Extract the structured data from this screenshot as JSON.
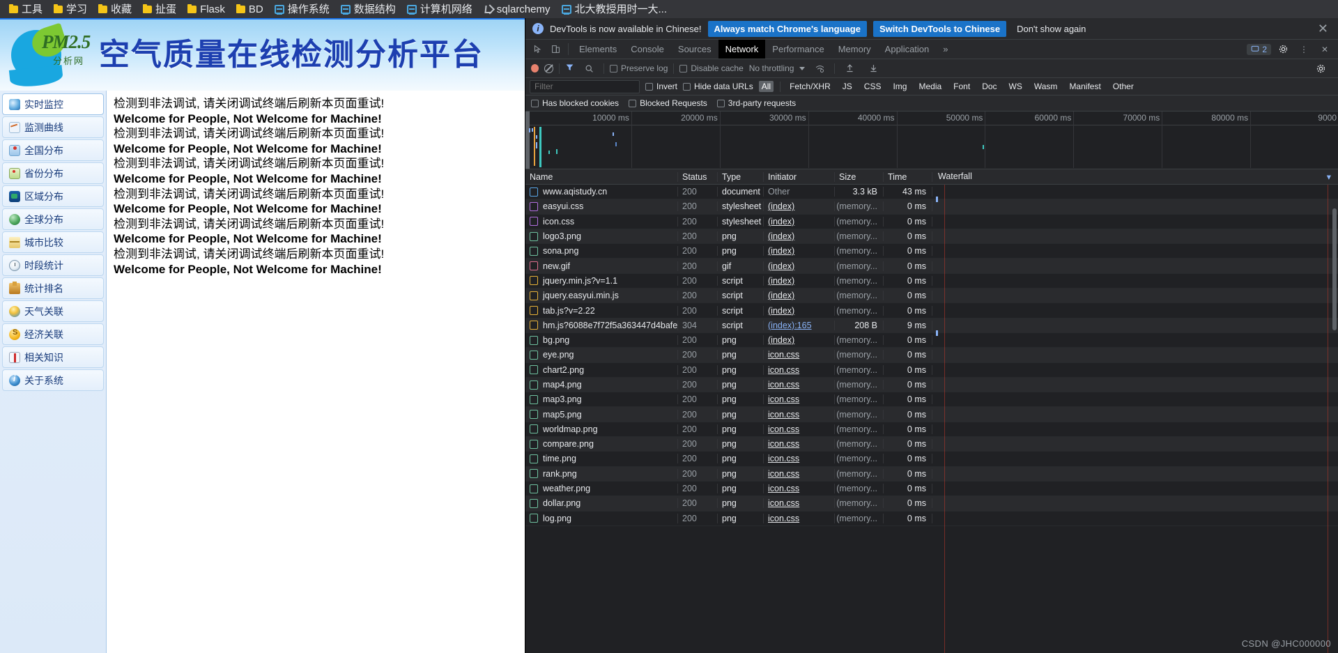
{
  "bookmarks": [
    {
      "label": "工具",
      "icon": "folder-icon"
    },
    {
      "label": "学习",
      "icon": "folder-icon"
    },
    {
      "label": "收藏",
      "icon": "folder-icon"
    },
    {
      "label": "扯蛋",
      "icon": "folder-icon"
    },
    {
      "label": "Flask",
      "icon": "folder-icon"
    },
    {
      "label": "BD",
      "icon": "folder-icon"
    },
    {
      "label": "操作系统",
      "icon": "page-icon"
    },
    {
      "label": "数据结构",
      "icon": "page-icon"
    },
    {
      "label": "计算机网络",
      "icon": "page-icon"
    },
    {
      "label": "sqlarchemy",
      "icon": "bookmark-alt-icon"
    },
    {
      "label": "北大教授用时一大...",
      "icon": "page-icon"
    }
  ],
  "site": {
    "logo_main": "PM2.5",
    "logo_sub": "分析网",
    "title": "空气质量在线检测分析平台"
  },
  "sidebar": {
    "items": [
      {
        "label": "实时监控",
        "icon": "realtime-monitor-icon",
        "active": true
      },
      {
        "label": "监测曲线",
        "icon": "chart-curve-icon",
        "active": false
      },
      {
        "label": "全国分布",
        "icon": "china-map-icon",
        "active": false
      },
      {
        "label": "省份分布",
        "icon": "province-map-icon",
        "active": false
      },
      {
        "label": "区域分布",
        "icon": "region-map-icon",
        "active": false
      },
      {
        "label": "全球分布",
        "icon": "globe-icon",
        "active": false
      },
      {
        "label": "城市比较",
        "icon": "compare-scale-icon",
        "active": false
      },
      {
        "label": "时段统计",
        "icon": "clock-icon",
        "active": false
      },
      {
        "label": "统计排名",
        "icon": "rank-podium-icon",
        "active": false
      },
      {
        "label": "天气关联",
        "icon": "weather-icon",
        "active": false
      },
      {
        "label": "经济关联",
        "icon": "coin-icon",
        "active": false
      },
      {
        "label": "相关知识",
        "icon": "book-icon",
        "active": false
      },
      {
        "label": "关于系统",
        "icon": "info-icon",
        "active": false
      }
    ]
  },
  "content": {
    "lines": [
      {
        "text": "检测到非法调试, 请关闭调试终端后刷新本页面重试!",
        "style": "cn"
      },
      {
        "text": "Welcome for People, Not Welcome for Machine!",
        "style": "en"
      },
      {
        "text": "检测到非法调试, 请关闭调试终端后刷新本页面重试!",
        "style": "cn"
      },
      {
        "text": "Welcome for People, Not Welcome for Machine!",
        "style": "en"
      },
      {
        "text": "检测到非法调试, 请关闭调试终端后刷新本页面重试!",
        "style": "cn"
      },
      {
        "text": "Welcome for People, Not Welcome for Machine!",
        "style": "en"
      },
      {
        "text": "检测到非法调试, 请关闭调试终端后刷新本页面重试!",
        "style": "cn"
      },
      {
        "text": "Welcome for People, Not Welcome for Machine!",
        "style": "en"
      },
      {
        "text": "检测到非法调试, 请关闭调试终端后刷新本页面重试!",
        "style": "cn"
      },
      {
        "text": "Welcome for People, Not Welcome for Machine!",
        "style": "en"
      },
      {
        "text": "检测到非法调试, 请关闭调试终端后刷新本页面重试!",
        "style": "cn"
      },
      {
        "text": "Welcome for People, Not Welcome for Machine!",
        "style": "en"
      }
    ]
  },
  "devtools": {
    "infobar": {
      "message": "DevTools is now available in Chinese!",
      "primary_button": "Always match Chrome's language",
      "secondary_button": "Switch DevTools to Chinese",
      "dismiss_button": "Don't show again",
      "close": "✕"
    },
    "tabs": [
      {
        "label": "Elements",
        "active": false
      },
      {
        "label": "Console",
        "active": false
      },
      {
        "label": "Sources",
        "active": false
      },
      {
        "label": "Network",
        "active": true
      },
      {
        "label": "Performance",
        "active": false
      },
      {
        "label": "Memory",
        "active": false
      },
      {
        "label": "Application",
        "active": false
      }
    ],
    "tabs_overflow": "»",
    "issues_count": "2",
    "toolbar": {
      "preserve_log": "Preserve log",
      "disable_cache": "Disable cache",
      "throttling": "No throttling"
    },
    "filterbar": {
      "filter_placeholder": "Filter",
      "invert": "Invert",
      "hide_data_urls": "Hide data URLs",
      "types": [
        "All",
        "Fetch/XHR",
        "JS",
        "CSS",
        "Img",
        "Media",
        "Font",
        "Doc",
        "WS",
        "Wasm",
        "Manifest",
        "Other"
      ],
      "active_type": "All"
    },
    "filterbar2": {
      "has_blocked_cookies": "Has blocked cookies",
      "blocked_requests": "Blocked Requests",
      "third_party_requests": "3rd-party requests"
    },
    "overview_ticks": [
      "10000 ms",
      "20000 ms",
      "30000 ms",
      "40000 ms",
      "50000 ms",
      "60000 ms",
      "70000 ms",
      "80000 ms",
      "9000"
    ],
    "table": {
      "columns": [
        "Name",
        "Status",
        "Type",
        "Initiator",
        "Size",
        "Time",
        "Waterfall"
      ],
      "rows": [
        {
          "name": "www.aqistudy.cn",
          "icon": "document-file-icon",
          "status": "200",
          "type": "document",
          "initiator": "Other",
          "initiator_style": "muted",
          "size": "3.3 kB",
          "time": "43 ms"
        },
        {
          "name": "easyui.css",
          "icon": "stylesheet-file-icon",
          "status": "200",
          "type": "stylesheet",
          "initiator": "(index)",
          "initiator_style": "link",
          "size": "(memory...",
          "time": "0 ms"
        },
        {
          "name": "icon.css",
          "icon": "stylesheet-file-icon",
          "status": "200",
          "type": "stylesheet",
          "initiator": "(index)",
          "initiator_style": "link",
          "size": "(memory...",
          "time": "0 ms"
        },
        {
          "name": "logo3.png",
          "icon": "image-file-icon",
          "status": "200",
          "type": "png",
          "initiator": "(index)",
          "initiator_style": "link",
          "size": "(memory...",
          "time": "0 ms"
        },
        {
          "name": "sona.png",
          "icon": "image-file-icon",
          "status": "200",
          "type": "png",
          "initiator": "(index)",
          "initiator_style": "link",
          "size": "(memory...",
          "time": "0 ms"
        },
        {
          "name": "new.gif",
          "icon": "gif-file-icon",
          "status": "200",
          "type": "gif",
          "initiator": "(index)",
          "initiator_style": "link",
          "size": "(memory...",
          "time": "0 ms"
        },
        {
          "name": "jquery.min.js?v=1.1",
          "icon": "script-file-icon",
          "status": "200",
          "type": "script",
          "initiator": "(index)",
          "initiator_style": "link",
          "size": "(memory...",
          "time": "0 ms"
        },
        {
          "name": "jquery.easyui.min.js",
          "icon": "script-file-icon",
          "status": "200",
          "type": "script",
          "initiator": "(index)",
          "initiator_style": "link",
          "size": "(memory...",
          "time": "0 ms"
        },
        {
          "name": "tab.js?v=2.22",
          "icon": "script-file-icon",
          "status": "200",
          "type": "script",
          "initiator": "(index)",
          "initiator_style": "link",
          "size": "(memory...",
          "time": "0 ms"
        },
        {
          "name": "hm.js?6088e7f72f5a363447d4bafe...",
          "icon": "script-file-icon",
          "status": "304",
          "type": "script",
          "initiator": "(index):165",
          "initiator_style": "link-blue",
          "size": "208 B",
          "time": "9 ms"
        },
        {
          "name": "bg.png",
          "icon": "image-file-icon",
          "status": "200",
          "type": "png",
          "initiator": "(index)",
          "initiator_style": "link",
          "size": "(memory...",
          "time": "0 ms"
        },
        {
          "name": "eye.png",
          "icon": "image-file-icon",
          "status": "200",
          "type": "png",
          "initiator": "icon.css",
          "initiator_style": "link",
          "size": "(memory...",
          "time": "0 ms"
        },
        {
          "name": "chart2.png",
          "icon": "image-file-icon",
          "status": "200",
          "type": "png",
          "initiator": "icon.css",
          "initiator_style": "link",
          "size": "(memory...",
          "time": "0 ms"
        },
        {
          "name": "map4.png",
          "icon": "image-file-icon",
          "status": "200",
          "type": "png",
          "initiator": "icon.css",
          "initiator_style": "link",
          "size": "(memory...",
          "time": "0 ms"
        },
        {
          "name": "map3.png",
          "icon": "image-file-icon",
          "status": "200",
          "type": "png",
          "initiator": "icon.css",
          "initiator_style": "link",
          "size": "(memory...",
          "time": "0 ms"
        },
        {
          "name": "map5.png",
          "icon": "image-file-icon",
          "status": "200",
          "type": "png",
          "initiator": "icon.css",
          "initiator_style": "link",
          "size": "(memory...",
          "time": "0 ms"
        },
        {
          "name": "worldmap.png",
          "icon": "image-file-icon",
          "status": "200",
          "type": "png",
          "initiator": "icon.css",
          "initiator_style": "link",
          "size": "(memory...",
          "time": "0 ms"
        },
        {
          "name": "compare.png",
          "icon": "image-file-icon",
          "status": "200",
          "type": "png",
          "initiator": "icon.css",
          "initiator_style": "link",
          "size": "(memory...",
          "time": "0 ms"
        },
        {
          "name": "time.png",
          "icon": "image-file-icon",
          "status": "200",
          "type": "png",
          "initiator": "icon.css",
          "initiator_style": "link",
          "size": "(memory...",
          "time": "0 ms"
        },
        {
          "name": "rank.png",
          "icon": "image-file-icon",
          "status": "200",
          "type": "png",
          "initiator": "icon.css",
          "initiator_style": "link",
          "size": "(memory...",
          "time": "0 ms"
        },
        {
          "name": "weather.png",
          "icon": "image-file-icon",
          "status": "200",
          "type": "png",
          "initiator": "icon.css",
          "initiator_style": "link",
          "size": "(memory...",
          "time": "0 ms"
        },
        {
          "name": "dollar.png",
          "icon": "image-file-icon",
          "status": "200",
          "type": "png",
          "initiator": "icon.css",
          "initiator_style": "link",
          "size": "(memory...",
          "time": "0 ms"
        },
        {
          "name": "log.png",
          "icon": "image-file-icon",
          "status": "200",
          "type": "png",
          "initiator": "icon.css",
          "initiator_style": "link",
          "size": "(memory...",
          "time": "0 ms"
        }
      ]
    }
  },
  "watermark": "CSDN @JHC000000"
}
